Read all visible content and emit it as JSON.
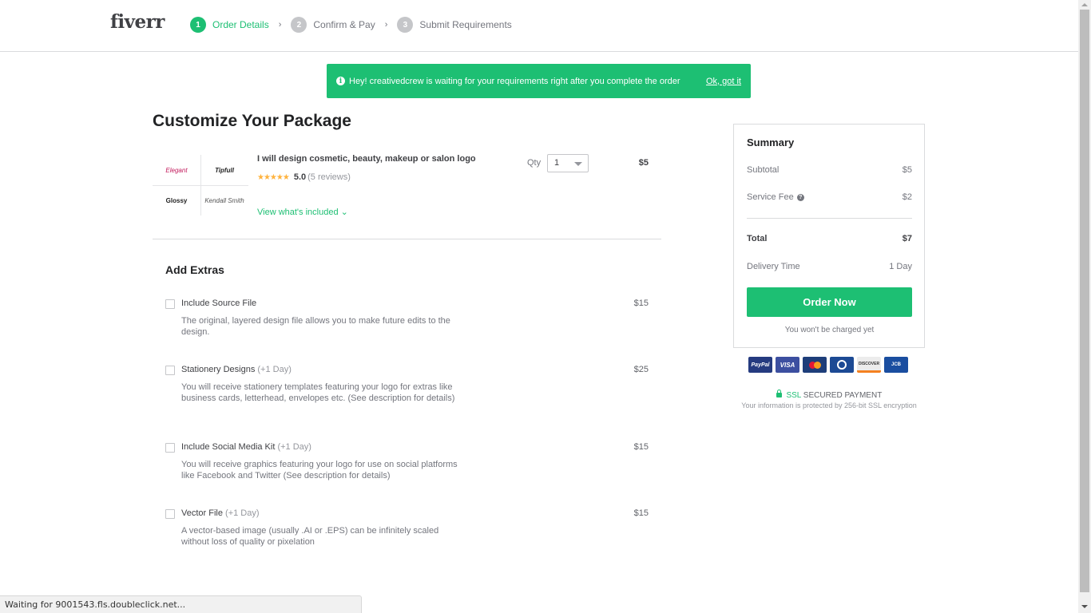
{
  "header": {
    "logo": "fiverr",
    "steps": [
      {
        "num": "1",
        "label": "Order Details",
        "state": "active"
      },
      {
        "num": "2",
        "label": "Confirm & Pay",
        "state": "inactive"
      },
      {
        "num": "3",
        "label": "Submit Requirements",
        "state": "inactive"
      }
    ],
    "separator": "›"
  },
  "banner": {
    "icon": "info-icon",
    "icon_glyph": "i",
    "text": "Hey! creativedcrew is waiting for your requirements right after you complete the order",
    "link": "Ok, got it"
  },
  "main": {
    "title": "Customize Your Package",
    "gig": {
      "image_labels": [
        "Elegant",
        "Tipfull",
        "Glossy",
        "Kendall Smith"
      ],
      "title": "I will design cosmetic, beauty, makeup or salon logo",
      "stars": "★★★★★",
      "rating": "5.0",
      "reviews": "(5 reviews)",
      "view_included": "View what's included ⌄",
      "qty_label": "Qty",
      "qty_value": "1",
      "price": "$5"
    },
    "extras_title": "Add Extras",
    "extras": [
      {
        "name": "Include Source File",
        "days": "",
        "desc": "The original, layered design file allows you to make future edits to the design.",
        "price": "$15",
        "checked": false
      },
      {
        "name": "Stationery Designs",
        "days": "(+1 Day)",
        "desc": "You will receive stationery templates featuring your logo for extras like business cards, letterhead, envelopes etc. (See description for details)",
        "price": "$25",
        "checked": false
      },
      {
        "name": "Include Social Media Kit",
        "days": "(+1 Day)",
        "desc": "You will receive graphics featuring your logo for use on social platforms like Facebook and Twitter (See description for details)",
        "price": "$15",
        "checked": false
      },
      {
        "name": "Vector File",
        "days": "(+1 Day)",
        "desc": "A vector-based image (usually .AI or .EPS) can be infinitely scaled without loss of quality or pixelation",
        "price": "$15",
        "checked": false
      }
    ]
  },
  "summary": {
    "title": "Summary",
    "subtotal_label": "Subtotal",
    "subtotal_value": "$5",
    "service_fee_label": "Service Fee",
    "service_fee_value": "$2",
    "total_label": "Total",
    "total_value": "$7",
    "delivery_label": "Delivery Time",
    "delivery_value": "1 Day",
    "order_button": "Order Now",
    "charged_note": "You won't be charged yet"
  },
  "payment": {
    "cards": [
      "PayPal",
      "VISA",
      "MasterCard",
      "Diners Club",
      "DISCOVER",
      "JCB"
    ],
    "ssl_label": "SSL",
    "secured_label": "SECURED PAYMENT",
    "ssl_note": "Your information is protected by 256-bit SSL encryption"
  },
  "browser": {
    "status_text": "Waiting for 9001543.fls.doubleclick.net..."
  },
  "colors": {
    "brand_green": "#1dbf73",
    "star": "#ffb33e"
  }
}
